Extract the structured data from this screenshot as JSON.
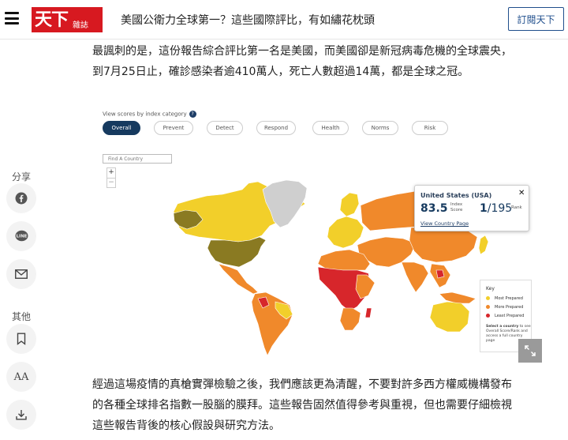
{
  "header": {
    "logo_main": "天下",
    "logo_sub": "雜誌",
    "title": "美國公衛力全球第一？這些國際評比，有如繡花枕頭",
    "subscribe_label": "訂閱天下"
  },
  "article": {
    "para1_line1": "最諷刺的是，這份報告綜合評比第一名是美國，而美國卻是新冠病毒危機的全球震央，",
    "para1_line2": "到7月25日止，確診感染者逾410萬人，死亡人數超過14萬，都是全球之冠。",
    "para2_line1": "經過這場疫情的真槍實彈檢驗之後，我們應該更為清醒，不要對許多西方權威機構發布",
    "para2_line2": "的各種全球排名指數一股腦的膜拜。這些報告固然值得參考與重視，但也需要仔細檢視",
    "para2_line3": "這些報告背後的核心假設與研究方法。"
  },
  "share": {
    "share_label": "分享",
    "other_label": "其他",
    "font_size_glyph": "AA"
  },
  "map_widget": {
    "category_label": "View scores by index category",
    "help_glyph": "?",
    "tabs": [
      "Overall",
      "Prevent",
      "Detect",
      "Respond",
      "Health",
      "Norms",
      "Risk"
    ],
    "active_tab": "Overall",
    "search_placeholder": "Find A Country",
    "zoom_in": "+",
    "zoom_out": "−",
    "popup": {
      "country": "United States (USA)",
      "close_glyph": "✕",
      "score": "83.5",
      "score_label": "Index Score",
      "rank": "1",
      "rank_total": "/195",
      "rank_label": "Rank",
      "link": "View Country Page"
    },
    "key": {
      "title": "Key",
      "items": [
        {
          "label": "Most Prepared",
          "color": "#f2cf2a"
        },
        {
          "label": "More Prepared",
          "color": "#f0892b"
        },
        {
          "label": "Least Prepared",
          "color": "#d7262b"
        }
      ],
      "note_bold": "Select a country",
      "note_rest": " to see Overall Score/Rank and access a full country page"
    },
    "colors": {
      "most": "#f2cf2a",
      "more": "#f0892b",
      "least": "#d7262b",
      "top": "#8a7a22",
      "nodata": "#cfcfcf"
    }
  }
}
